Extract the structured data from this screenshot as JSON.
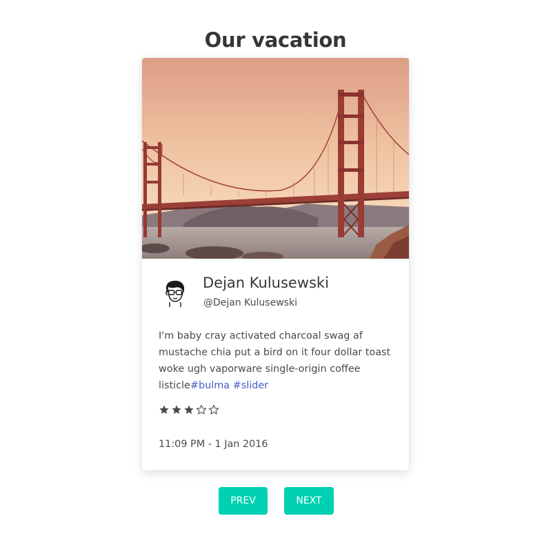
{
  "page": {
    "title": "Our vacation"
  },
  "card": {
    "image_icon": "golden-gate-bridge-photo",
    "author": {
      "name": "Dejan Kulusewski",
      "handle": "@Dejan Kulusewski",
      "avatar_icon": "avatar-icon"
    },
    "text": "I'm baby cray activated charcoal swag af mustache chia put a bird on it four dollar toast woke ugh vaporware single-origin coffee listicle",
    "tags": [
      "#bulma",
      "#slider"
    ],
    "rating": {
      "value": 3,
      "max": 5,
      "color": "#4a4a4a"
    },
    "date": "11:09 PM - 1 Jan 2016"
  },
  "controls": {
    "prev_label": "PREV",
    "next_label": "NEXT",
    "accent": "#00d1b2"
  }
}
